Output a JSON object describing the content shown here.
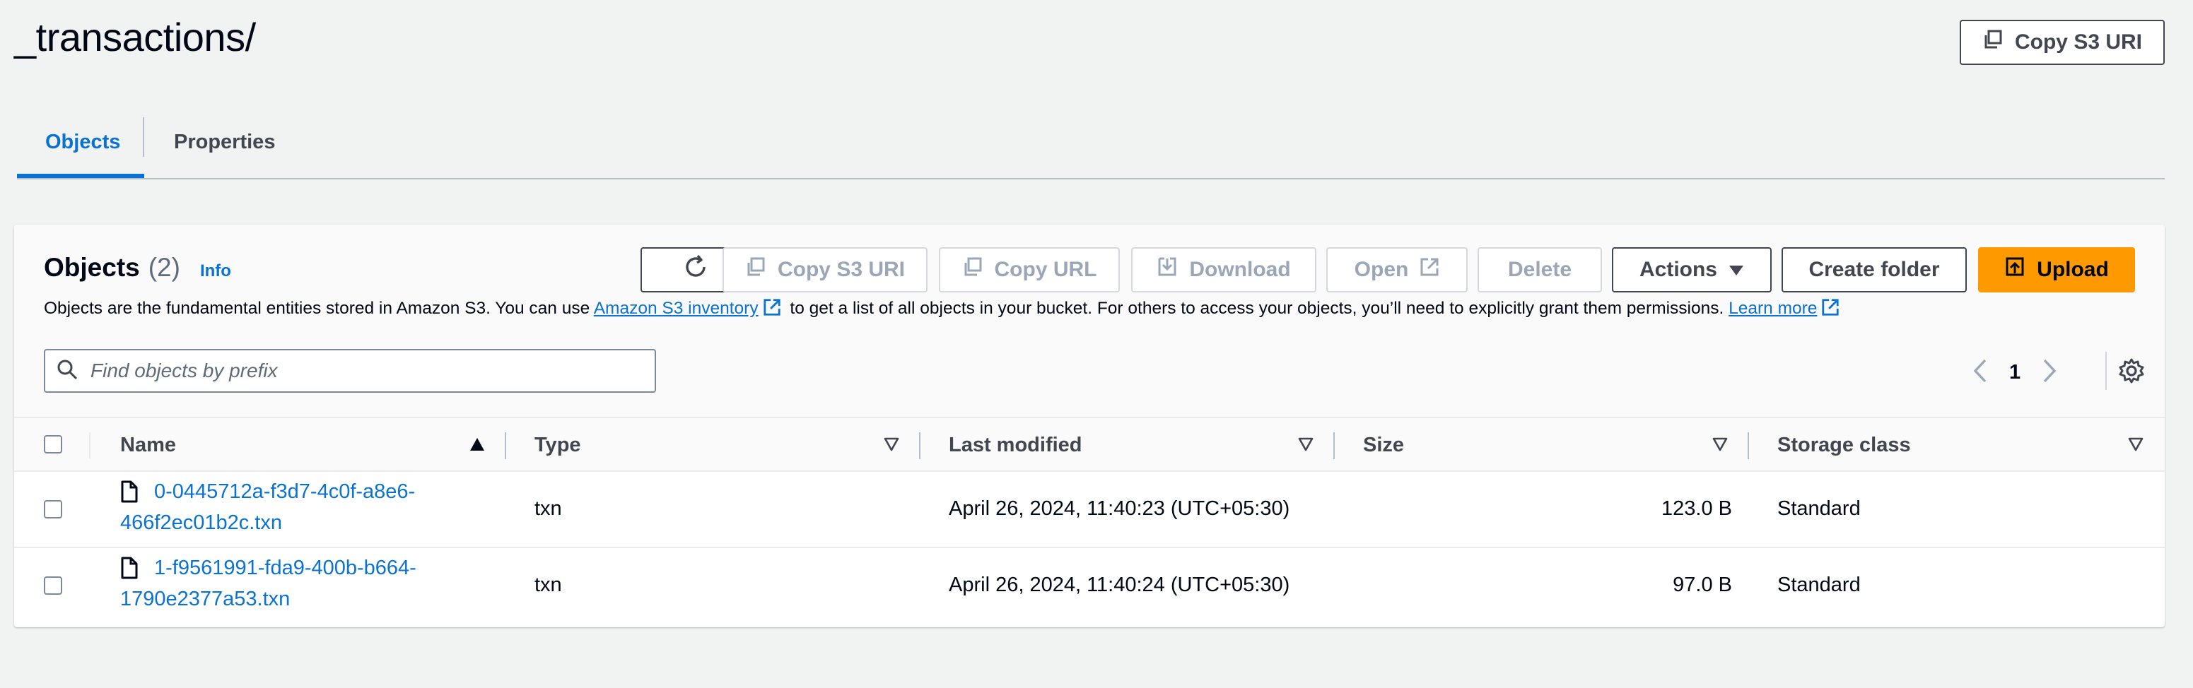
{
  "header": {
    "title": "_transactions/",
    "copy_s3_uri_label": "Copy S3 URI"
  },
  "tabs": [
    {
      "label": "Objects",
      "active": true
    },
    {
      "label": "Properties",
      "active": false
    }
  ],
  "objects_panel": {
    "title": "Objects",
    "count": "(2)",
    "info_label": "Info",
    "description": {
      "text_before": "Objects are the fundamental entities stored in Amazon S3. You can use",
      "inventory_link": "Amazon S3 inventory",
      "text_after": "to get a list of all objects in your bucket. For others to access your objects, you’ll need to explicitly grant them permissions.",
      "learn_more_link": "Learn more"
    },
    "toolbar": {
      "copy_s3_uri": "Copy S3 URI",
      "copy_url": "Copy URL",
      "download": "Download",
      "open": "Open",
      "delete": "Delete",
      "actions": "Actions",
      "create_folder": "Create folder",
      "upload": "Upload"
    },
    "search": {
      "placeholder": "Find objects by prefix",
      "value": ""
    },
    "pagination": {
      "current_page": "1"
    }
  },
  "table": {
    "columns": [
      "Name",
      "Type",
      "Last modified",
      "Size",
      "Storage class"
    ],
    "sort_column": "Name",
    "rows": [
      {
        "name_line1": "0-0445712a-f3d7-4c0f-a8e6-",
        "name_line2": "466f2ec01b2c.txn",
        "type": "txn",
        "last_modified": "April 26, 2024, 11:40:23 (UTC+05:30)",
        "size": "123.0 B",
        "storage_class": "Standard"
      },
      {
        "name_line1": "1-f9561991-fda9-400b-b664-",
        "name_line2": "1790e2377a53.txn",
        "type": "txn",
        "last_modified": "April 26, 2024, 11:40:24 (UTC+05:30)",
        "size": "97.0 B",
        "storage_class": "Standard"
      }
    ]
  },
  "colors": {
    "accent_link": "#0972d3",
    "primary_button": "#ff9900",
    "page_background": "#f1f2f2"
  },
  "icons": [
    "copy-icon",
    "refresh-icon",
    "download-icon",
    "external-link-icon",
    "caret-down-icon",
    "upload-icon",
    "search-icon",
    "chevron-left-icon",
    "chevron-right-icon",
    "gear-icon",
    "file-icon",
    "sort-ascending-icon",
    "sort-descending-icon"
  ]
}
